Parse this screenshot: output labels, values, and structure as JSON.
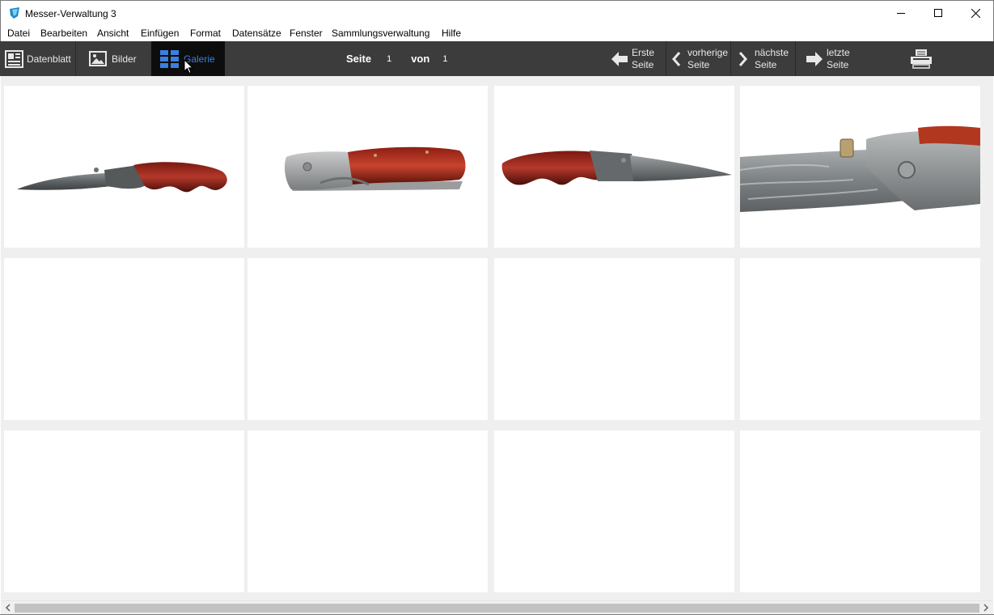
{
  "window": {
    "title": "Messer-Verwaltung 3"
  },
  "menu": [
    "Datei",
    "Bearbeiten",
    "Ansicht",
    "Einfügen",
    "Format",
    "Datensätze",
    "Fenster",
    "Sammlungsverwaltung",
    "Hilfe"
  ],
  "toolbar": {
    "datenblatt": "Datenblatt",
    "bilder": "Bilder",
    "galerie": "Galerie",
    "page_label": "Seite",
    "page_current": "1",
    "of_label": "von",
    "page_total": "1",
    "first": [
      "Erste",
      "Seite"
    ],
    "prev": [
      "vorherige",
      "Seite"
    ],
    "next": [
      "nächste",
      "Seite"
    ],
    "last": [
      "letzte",
      "Seite"
    ]
  },
  "colors": {
    "toolbar_bg": "#3c3c3c",
    "active_tab_bg": "#0d0d0d",
    "accent": "#3b7fe0",
    "gallery_bg": "#efefef"
  },
  "icons": {
    "app": "app-icon",
    "datenblatt": "datasheet-icon",
    "bilder": "image-icon",
    "galerie": "grid-icon",
    "first": "arrow-left-icon",
    "prev": "chevron-left-icon",
    "next": "chevron-right-icon",
    "last": "arrow-right-icon",
    "print": "printer-icon"
  }
}
